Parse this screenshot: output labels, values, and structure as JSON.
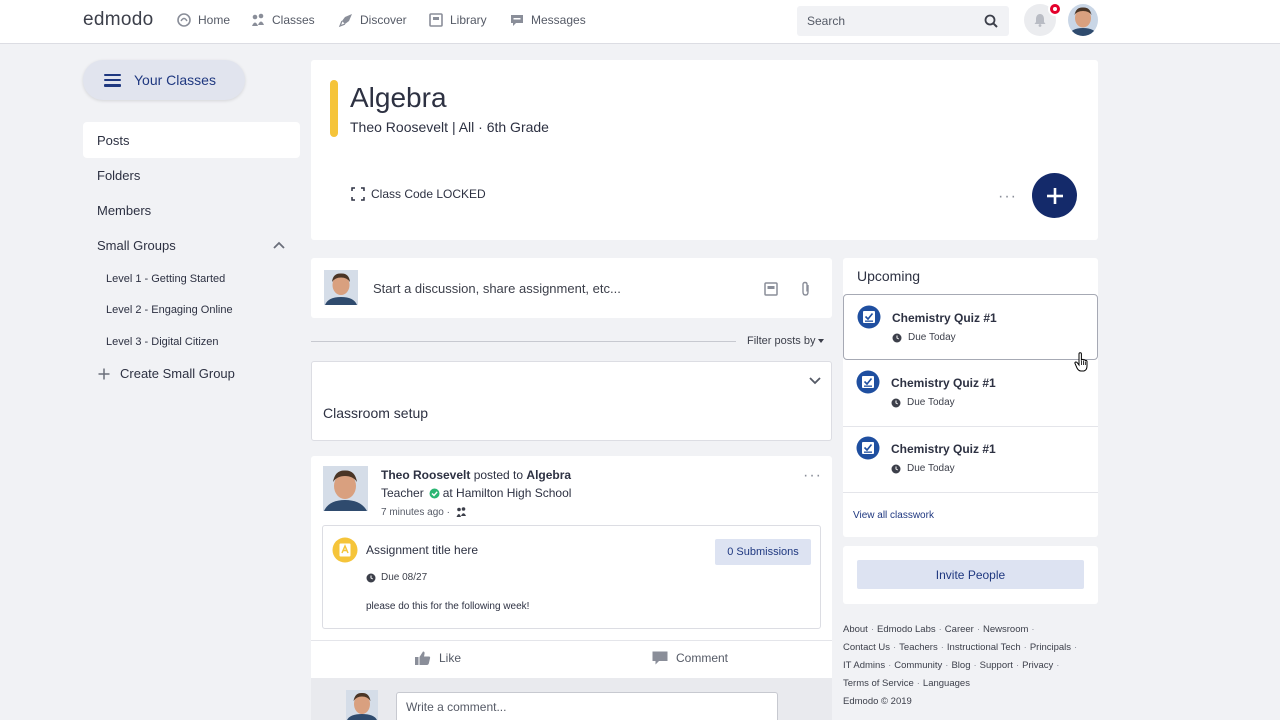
{
  "topbar": {
    "logo": "edmodo",
    "nav": [
      {
        "label": "Home",
        "icon": "home-icon"
      },
      {
        "label": "Classes",
        "icon": "classes-icon"
      },
      {
        "label": "Discover",
        "icon": "rocket-icon"
      },
      {
        "label": "Library",
        "icon": "library-icon"
      },
      {
        "label": "Messages",
        "icon": "messages-icon"
      }
    ],
    "search_placeholder": "Search"
  },
  "sidebar": {
    "your_classes": "Your Classes",
    "items": [
      {
        "label": "Posts",
        "active": true
      },
      {
        "label": "Folders"
      },
      {
        "label": "Members"
      },
      {
        "label": "Small Groups"
      }
    ],
    "small_groups": [
      {
        "label": "Level 1 - Getting Started"
      },
      {
        "label": "Level 2 - Engaging Online"
      },
      {
        "label": "Level 3 - Digital Citizen"
      }
    ],
    "create_small_group": "Create Small Group"
  },
  "class_header": {
    "title": "Algebra",
    "subtitle": "Theo Roosevelt | All  · 6th Grade",
    "class_code": "Class Code LOCKED",
    "color": "#f5c43a"
  },
  "composer": {
    "placeholder": "Start a discussion, share assignment, etc..."
  },
  "filter": {
    "label": "Filter posts by"
  },
  "classroom_setup": {
    "title": "Classroom setup"
  },
  "post": {
    "author": "Theo Roosevelt",
    "posted_to_text": " posted to ",
    "group": "Algebra",
    "role": "Teacher",
    "school": "at Hamilton High School",
    "time": "7 minutes ago ·",
    "assignment": {
      "title": "Assignment title here",
      "submissions": "0 Submissions",
      "due": "Due 08/27",
      "description": "please do this for the following week!"
    },
    "like": "Like",
    "comment": "Comment",
    "comment_placeholder": "Write a comment..."
  },
  "upcoming": {
    "title": "Upcoming",
    "items": [
      {
        "title": "Chemistry Quiz #1",
        "due": "Due Today"
      },
      {
        "title": "Chemistry Quiz #1",
        "due": "Due Today"
      },
      {
        "title": "Chemistry Quiz #1",
        "due": "Due Today"
      }
    ],
    "view_all": "View all classwork"
  },
  "invite": {
    "label": "Invite People"
  },
  "footer": {
    "row1": [
      "About",
      "Edmodo Labs",
      "Career",
      "Newsroom"
    ],
    "row2": [
      "Contact Us",
      "Teachers",
      "Instructional Tech",
      "Principals"
    ],
    "row3": [
      "IT Admins",
      "Community",
      "Blog",
      "Support",
      "Privacy"
    ],
    "row4": [
      "Terms of Service",
      "Languages"
    ],
    "copyright": "Edmodo © 2019"
  },
  "colors": {
    "brand_navy": "#142a6a",
    "accent_blue": "#1f3880",
    "button_bg": "#dde3f2",
    "notification_red": "#e4002b"
  }
}
